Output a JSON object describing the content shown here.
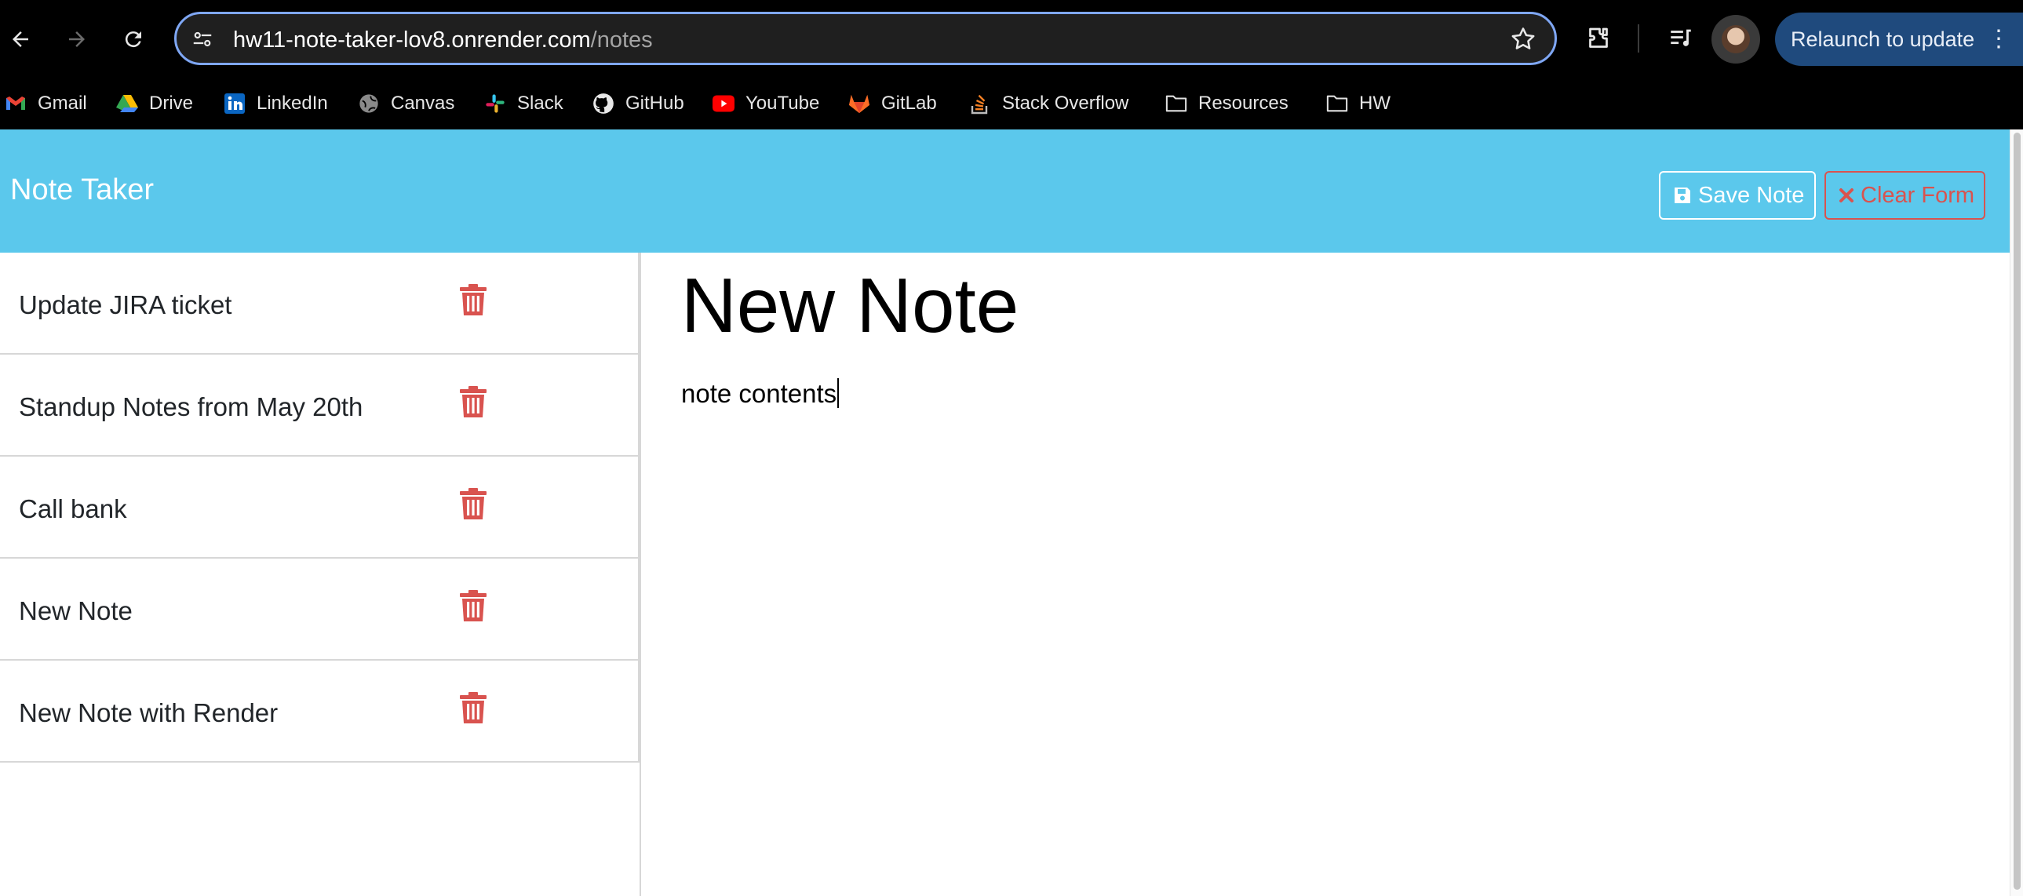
{
  "browser": {
    "url_host": "hw11-note-taker-lov8.onrender.com",
    "url_path": "/notes",
    "relaunch_label": "Relaunch to update",
    "bookmarks": [
      {
        "label": "Gmail",
        "icon": "gmail-icon"
      },
      {
        "label": "Drive",
        "icon": "drive-icon"
      },
      {
        "label": "LinkedIn",
        "icon": "linkedin-icon"
      },
      {
        "label": "Canvas",
        "icon": "canvas-icon"
      },
      {
        "label": "Slack",
        "icon": "slack-icon"
      },
      {
        "label": "GitHub",
        "icon": "github-icon"
      },
      {
        "label": "YouTube",
        "icon": "youtube-icon"
      },
      {
        "label": "GitLab",
        "icon": "gitlab-icon"
      },
      {
        "label": "Stack Overflow",
        "icon": "stackoverflow-icon"
      },
      {
        "label": "Resources",
        "icon": "folder-icon"
      },
      {
        "label": "HW",
        "icon": "folder-icon"
      }
    ]
  },
  "app": {
    "brand": "Note Taker",
    "save_label": "Save Note",
    "clear_label": "Clear Form",
    "colors": {
      "navbar": "#5bc8ec",
      "danger": "#d9534f"
    },
    "notes": [
      {
        "title": "Update JIRA ticket"
      },
      {
        "title": "Standup Notes from May 20th"
      },
      {
        "title": "Call bank"
      },
      {
        "title": "New Note"
      },
      {
        "title": "New Note with Render"
      }
    ],
    "editor": {
      "title": "New Note",
      "text": "note contents"
    }
  }
}
